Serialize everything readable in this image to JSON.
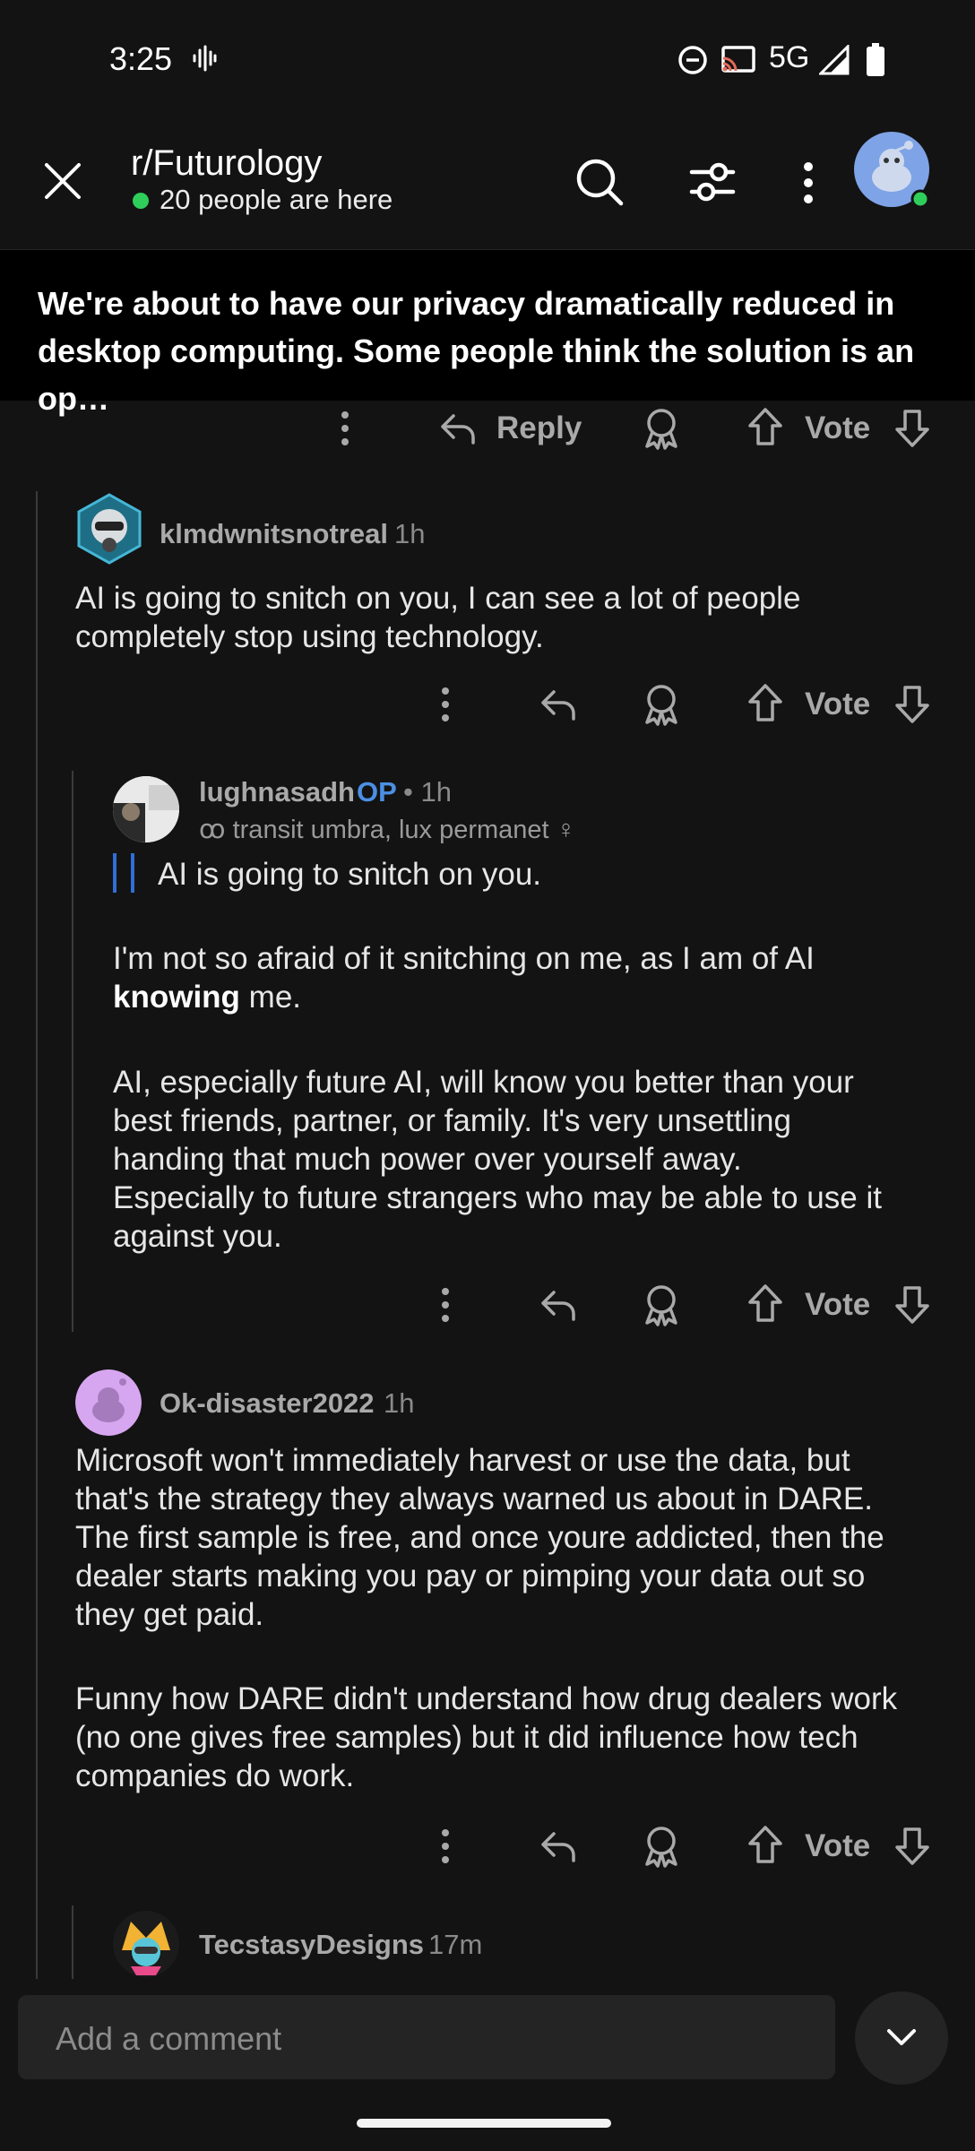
{
  "status_bar": {
    "time": "3:25",
    "network": "5G"
  },
  "header": {
    "subreddit": "r/Futurology",
    "online": "20 people are here"
  },
  "banner": {
    "title": "We're about to have our privacy dramatically reduced in desktop computing. Some people think the solution is an op…"
  },
  "top_actions": {
    "reply": "Reply",
    "vote": "Vote"
  },
  "comments": [
    {
      "user": "klmdwnitsnotreal",
      "age": "1h",
      "body": [
        "AI is going to snitch on you, I can see a lot of people",
        "completely stop using technology."
      ],
      "vote": "Vote"
    },
    {
      "user": "lughnasadh",
      "op": "OP",
      "age": "• 1h",
      "flair": "ꝏ transit umbra, lux permanet ♀",
      "quote": "AI is going to snitch on you.",
      "p1_line1": "I'm not so afraid of it snitching on me, as I am of AI",
      "p1_bold": "knowing",
      "p1_rest": " me.",
      "p2": [
        "AI, especially future AI, will know you better than your",
        "best friends, partner, or family. It's very unsettling",
        "handing that much power over yourself away.",
        "Especially to future strangers who may be able to use it",
        "against you."
      ],
      "vote": "Vote"
    },
    {
      "user": "Ok-disaster2022",
      "age": "1h",
      "p1": [
        "Microsoft won't immediately harvest or use the data, but",
        "that's the strategy they always warned us about in DARE.",
        "The first sample is free, and once youre addicted, then the",
        "dealer starts making you pay or pimping your data out so",
        "they get paid."
      ],
      "p2": [
        "Funny how DARE didn't understand how drug dealers work",
        "(no one gives free samples) but it did influence how tech",
        "companies do work."
      ],
      "vote": "Vote"
    },
    {
      "user": "TecstasyDesigns",
      "age": "17m"
    }
  ],
  "composer": {
    "placeholder": "Add a comment"
  },
  "colors": {
    "online": "#2fce5a",
    "op": "#4c8fe4",
    "quote_bar": "#2f6fd6",
    "background": "#131313"
  },
  "icons": [
    "close-icon",
    "search-icon",
    "filter-icon",
    "more-icon",
    "reply-icon",
    "award-icon",
    "upvote-icon",
    "downvote-icon",
    "chevron-down-icon"
  ]
}
